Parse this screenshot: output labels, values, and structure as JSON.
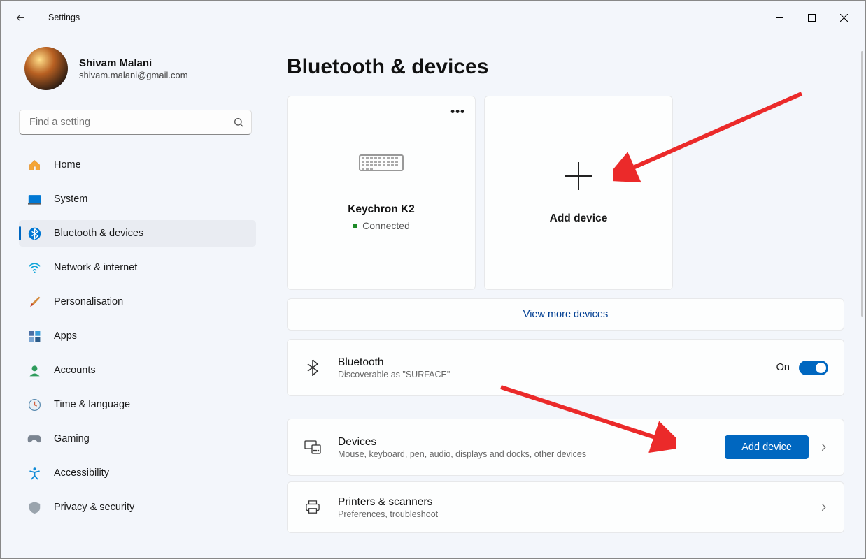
{
  "app_title": "Settings",
  "profile": {
    "name": "Shivam Malani",
    "email": "shivam.malani@gmail.com"
  },
  "search": {
    "placeholder": "Find a setting"
  },
  "nav": {
    "home": "Home",
    "system": "System",
    "bluetooth": "Bluetooth & devices",
    "network": "Network & internet",
    "personalisation": "Personalisation",
    "apps": "Apps",
    "accounts": "Accounts",
    "time": "Time & language",
    "gaming": "Gaming",
    "accessibility": "Accessibility",
    "privacy": "Privacy & security"
  },
  "page": {
    "title": "Bluetooth & devices"
  },
  "device_card": {
    "name": "Keychron K2",
    "status": "Connected"
  },
  "add_card": {
    "label": "Add device"
  },
  "view_more": "View more devices",
  "bluetooth_row": {
    "title": "Bluetooth",
    "subtitle": "Discoverable as \"SURFACE\"",
    "state": "On"
  },
  "devices_row": {
    "title": "Devices",
    "subtitle": "Mouse, keyboard, pen, audio, displays and docks, other devices",
    "button": "Add device"
  },
  "printers_row": {
    "title": "Printers & scanners",
    "subtitle": "Preferences, troubleshoot"
  }
}
